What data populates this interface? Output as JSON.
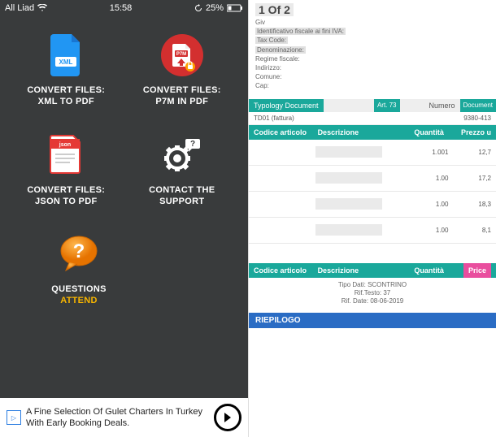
{
  "status": {
    "carrier": "All Liad",
    "time": "15:58",
    "battery": "25%"
  },
  "tiles": {
    "xml": {
      "l1": "CONVERT FILES:",
      "l2": "XML TO PDF "
    },
    "p7m": {
      "l1": "CONVERT FILES:",
      "l2": "P7M IN PDF "
    },
    "json": {
      "l1": "CONVERT FILES:",
      "l2": "JSON TO PDF "
    },
    "support": {
      "l1": "CONTACT THE",
      "l2": "SUPPORT "
    },
    "faq": {
      "l1": "QUESTIONS",
      "l2": "ATTEND"
    }
  },
  "ad": {
    "text": "A Fine Selection Of Gulet Charters In Turkey With Early Booking Deals."
  },
  "doc": {
    "page": "1 Of 2",
    "meta": [
      "Giv",
      "Identificativo fiscale ai fini IVA:",
      "Tax Code:",
      "Denominazione:",
      "Regime fiscale:",
      "Indirizzo:",
      "Comune:",
      "Cap:"
    ],
    "bar1": {
      "a": "Typology Document",
      "b": "Art. 73",
      "c": "Numero",
      "d": "Document"
    },
    "sub1": {
      "a": "TD01 (fattura)",
      "b": "9380-413"
    },
    "hdr": {
      "ca": "Codice articolo",
      "cd": "Descrizione",
      "cq": "Quantità",
      "cp": "Prezzo u"
    },
    "rows": [
      {
        "q": "1.001",
        "p": "12,7"
      },
      {
        "q": "1.00",
        "p": "17,2"
      },
      {
        "q": "1.00",
        "p": "18,3"
      },
      {
        "q": "1.00",
        "p": "8,1"
      }
    ],
    "hdr2": {
      "ca": "Codice articolo",
      "cd": "Descrizione",
      "cq": "Quantità",
      "cp": "Price"
    },
    "footer": {
      "l1": "Tipo Dati: SCONTRINO",
      "l2": "Rif.Testo: 37",
      "l3": "Rif. Date: 08-06-2019"
    },
    "riepilogo": "RIEPILOGO"
  }
}
